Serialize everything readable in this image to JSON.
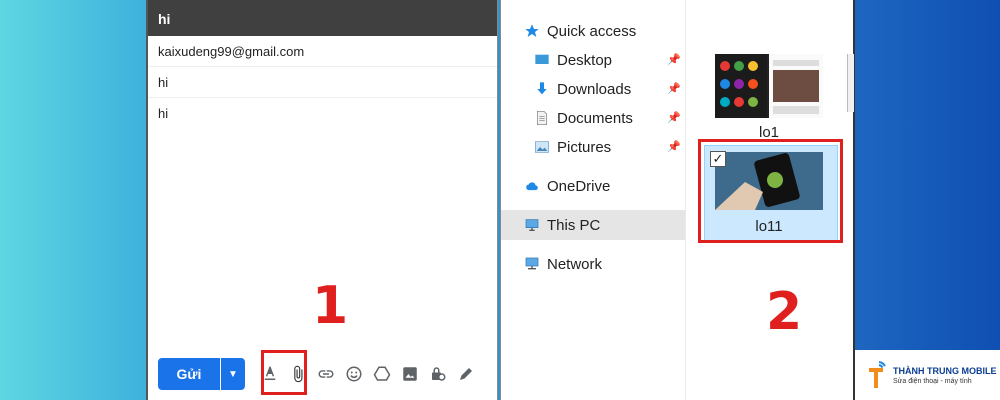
{
  "compose": {
    "title": "hi",
    "to": "kaixudeng99@gmail.com",
    "subject": "hi",
    "body": "hi",
    "send_label": "Gửi"
  },
  "explorer": {
    "nav": [
      {
        "label": "Quick access",
        "icon": "star-icon"
      },
      {
        "label": "Desktop",
        "icon": "desktop-folder-icon",
        "pinned": true
      },
      {
        "label": "Downloads",
        "icon": "download-arrow-icon",
        "pinned": true
      },
      {
        "label": "Documents",
        "icon": "document-icon",
        "pinned": true
      },
      {
        "label": "Pictures",
        "icon": "pictures-icon",
        "pinned": true
      },
      {
        "label": "OneDrive",
        "icon": "cloud-icon"
      },
      {
        "label": "This PC",
        "icon": "computer-icon",
        "selected": true
      },
      {
        "label": "Network",
        "icon": "network-icon"
      }
    ],
    "files": [
      {
        "name": "lo1",
        "selected": false
      },
      {
        "name": "lo11",
        "selected": true
      }
    ]
  },
  "steps": {
    "step1": "1",
    "step2": "2"
  },
  "brand": {
    "name": "THÀNH TRUNG MOBILE",
    "tagline": "Sửa điện thoại - máy tính"
  },
  "colors": {
    "accent": "#1a73e8",
    "highlight": "#e01f1f",
    "selection": "#cce8ff"
  }
}
